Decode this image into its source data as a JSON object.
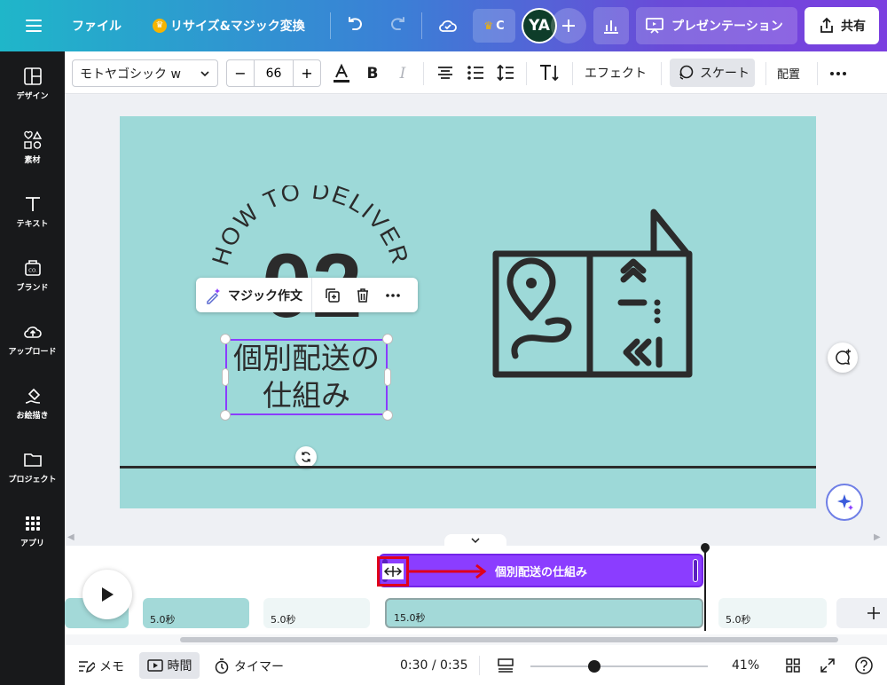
{
  "topbar": {
    "file_label": "ファイル",
    "resize_label": "リサイズ&マジック変換",
    "crown_short": "C",
    "avatar_initials": "YA",
    "present_label": "プレゼンテーション",
    "share_label": "共有"
  },
  "sidebar": {
    "items": [
      {
        "label": "デザイン",
        "icon": "layout-icon"
      },
      {
        "label": "素材",
        "icon": "shapes-icon"
      },
      {
        "label": "テキスト",
        "icon": "text-icon"
      },
      {
        "label": "ブランド",
        "icon": "brand-icon"
      },
      {
        "label": "アップロード",
        "icon": "upload-icon"
      },
      {
        "label": "お絵描き",
        "icon": "draw-icon"
      },
      {
        "label": "プロジェクト",
        "icon": "folder-icon"
      },
      {
        "label": "アプリ",
        "icon": "apps-icon"
      }
    ]
  },
  "toolbar": {
    "font_name": "モトヤゴシック w",
    "font_size": "66",
    "minus": "−",
    "plus": "+",
    "bold": "B",
    "italic": "I",
    "effect_label": "エフェクト",
    "skate_label": "スケート",
    "arrange_label": "配置"
  },
  "slide": {
    "arc_text": "HOW TO DELIVER",
    "number": "02",
    "title_line1": "個別配送の",
    "title_line2": "仕組み",
    "magic_write_label": "マジック作文"
  },
  "timeline": {
    "audio_label": "個別配送の仕組み",
    "thumbs": [
      {
        "duration": "5.0秒"
      },
      {
        "duration": "5.0秒"
      },
      {
        "duration": "15.0秒"
      },
      {
        "duration": "5.0秒"
      }
    ]
  },
  "bottom": {
    "memo_label": "メモ",
    "time_label": "時間",
    "timer_label": "タイマー",
    "time_readout": "0:30 / 0:35",
    "zoom": "41%",
    "zoom_fraction": 0.36
  },
  "colors": {
    "slide_bg": "#9dd9d8",
    "selection": "#8b3dff",
    "audio_track": "#8b3dff",
    "highlight": "#e0001b"
  }
}
